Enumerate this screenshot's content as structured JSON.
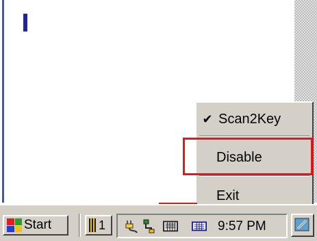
{
  "document": {
    "caret": "I"
  },
  "context_menu": {
    "items": [
      {
        "label": "Scan2Key",
        "checked": true,
        "check_glyph": "✔"
      },
      {
        "label": "Disable",
        "checked": false
      },
      {
        "label": "Exit",
        "checked": false
      }
    ]
  },
  "taskbar": {
    "start_label": "Start",
    "task_button_text": "1",
    "clock": "9:57 PM",
    "tray_icons": [
      "power-plug-icon",
      "network-icon",
      "keyboard-icon",
      "input-panel-icon"
    ],
    "desktop_icon": "show-desktop-icon"
  },
  "annotation_color": "#e11818"
}
